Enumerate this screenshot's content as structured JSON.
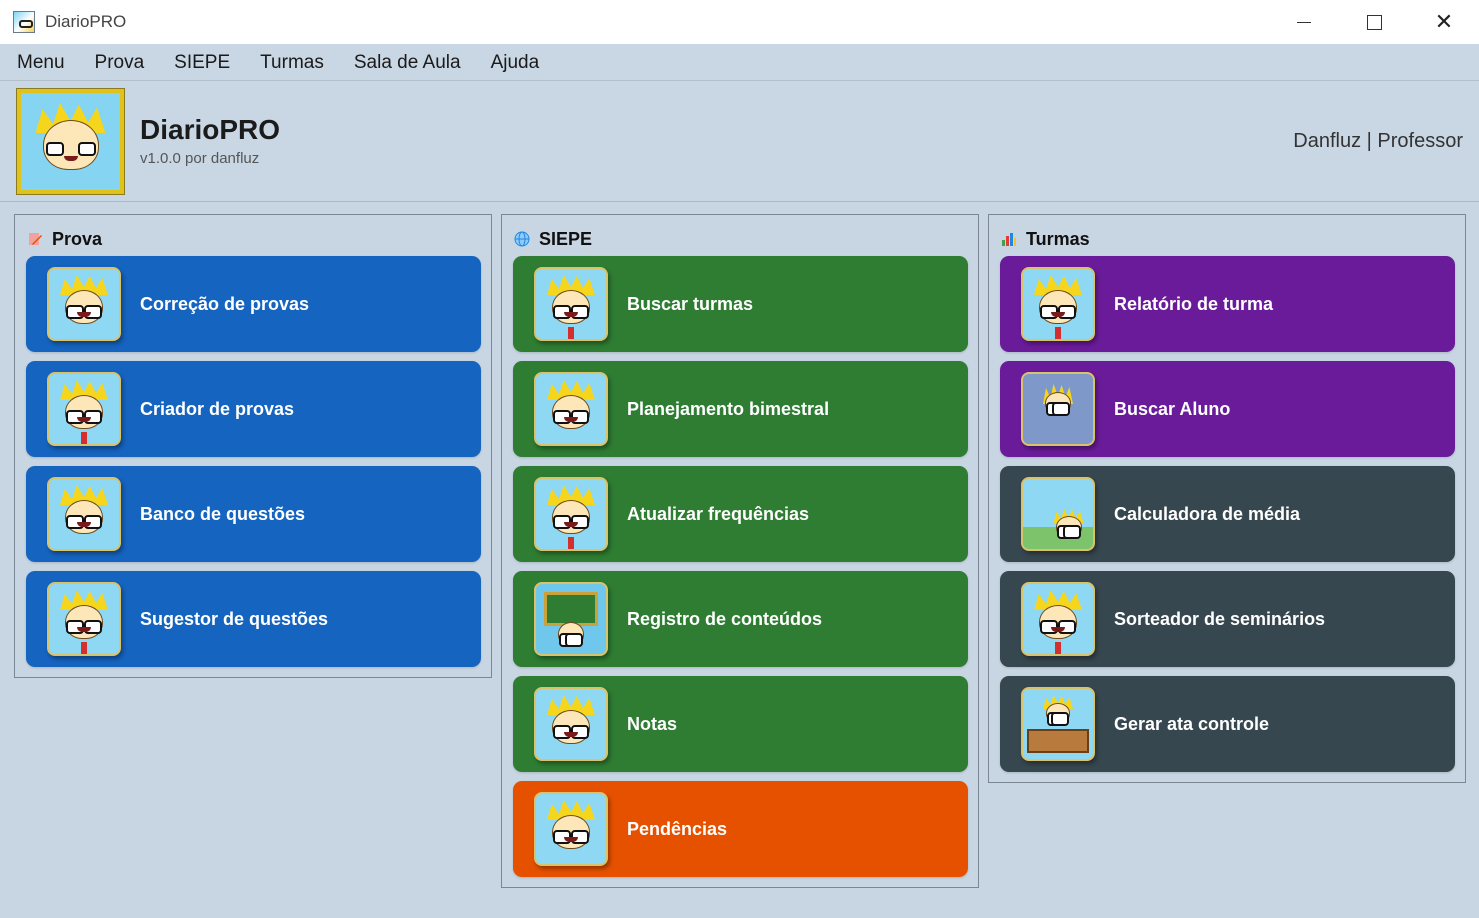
{
  "window": {
    "title": "DiarioPRO",
    "controls": {
      "minimize_icon": "minimize-icon",
      "maximize_icon": "maximize-icon",
      "close_icon": "close-icon",
      "close_glyph": "✕"
    }
  },
  "menu": {
    "items": [
      {
        "label": "Menu"
      },
      {
        "label": "Prova"
      },
      {
        "label": "SIEPE"
      },
      {
        "label": "Turmas"
      },
      {
        "label": "Sala de Aula"
      },
      {
        "label": "Ajuda"
      }
    ]
  },
  "header": {
    "app_name": "DiarioPRO",
    "version": "v1.0.0 por danfluz",
    "user": "Danfluz | Professor"
  },
  "panels": {
    "prova": {
      "title": "Prova",
      "icon": "pencil-icon",
      "tiles": [
        {
          "label": "Correção de provas",
          "icon": "professor-correcting-icon",
          "color": "#1564c0"
        },
        {
          "label": "Criador de provas",
          "icon": "professor-graduate-icon",
          "color": "#1564c0"
        },
        {
          "label": "Banco de questões",
          "icon": "professor-magnifier-icon",
          "color": "#1564c0"
        },
        {
          "label": "Sugestor de questões",
          "icon": "professor-idea-icon",
          "color": "#1564c0"
        }
      ]
    },
    "siepe": {
      "title": "SIEPE",
      "icon": "globe-icon",
      "tiles": [
        {
          "label": "Buscar turmas",
          "icon": "professor-search-icon",
          "color": "#2e7d32"
        },
        {
          "label": "Planejamento bimestral",
          "icon": "professor-planning-icon",
          "color": "#2e7d32"
        },
        {
          "label": "Atualizar frequências",
          "icon": "professor-attendance-icon",
          "color": "#2e7d32"
        },
        {
          "label": "Registro de conteúdos",
          "icon": "professor-blackboard-icon",
          "color": "#2e7d32"
        },
        {
          "label": "Notas",
          "icon": "professor-grades-icon",
          "color": "#2e7d32"
        },
        {
          "label": "Pendências",
          "icon": "professor-pending-icon",
          "color": "#e65100"
        }
      ]
    },
    "turmas": {
      "title": "Turmas",
      "icon": "bar-chart-icon",
      "tiles": [
        {
          "label": "Relatório de turma",
          "icon": "professor-report-icon",
          "color": "#6a1b9a"
        },
        {
          "label": "Buscar Aluno",
          "icon": "professor-find-student-icon",
          "color": "#6a1b9a"
        },
        {
          "label": "Calculadora de média",
          "icon": "professor-calculator-icon",
          "color": "#37474f"
        },
        {
          "label": "Sorteador de seminários",
          "icon": "professor-raffle-icon",
          "color": "#37474f"
        },
        {
          "label": "Gerar ata controle",
          "icon": "professor-desk-icon",
          "color": "#37474f"
        }
      ]
    }
  }
}
